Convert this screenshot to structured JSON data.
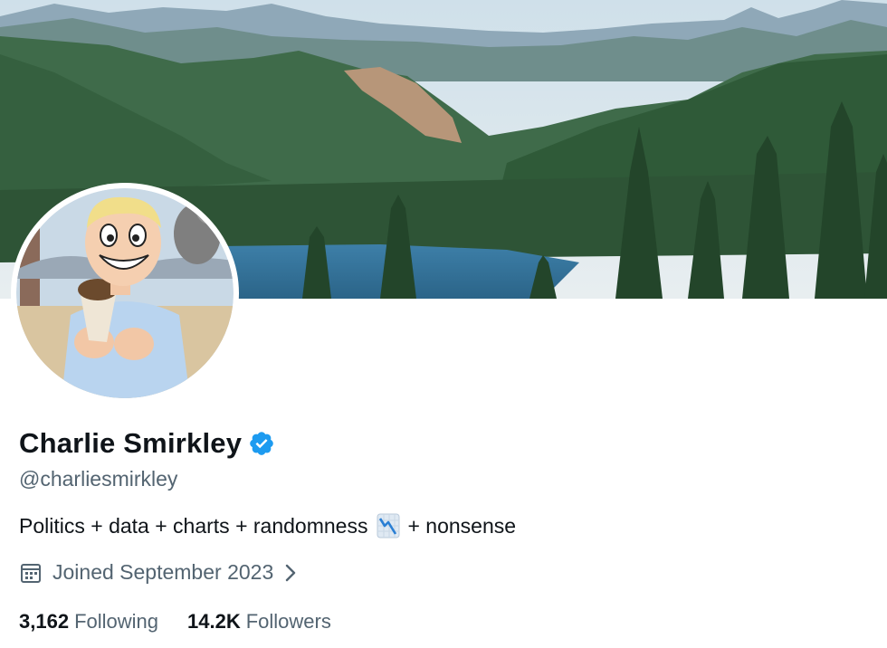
{
  "profile": {
    "display_name": "Charlie Smirkley",
    "handle": "@charliesmirkley",
    "bio_before_emoji": "Politics + data + charts + randomness",
    "bio_emoji": "chart-decreasing-icon",
    "bio_after_emoji": "+ nonsense",
    "joined": "Joined September 2023",
    "verified_icon": "verified-badge-icon",
    "verified_color": "#1d9bf0"
  },
  "stats": {
    "following_count": "3,162",
    "following_label": "Following",
    "followers_count": "14.2K",
    "followers_label": "Followers"
  },
  "colors": {
    "text_primary": "#0f1419",
    "text_secondary": "#536471",
    "accent": "#1d9bf0"
  }
}
